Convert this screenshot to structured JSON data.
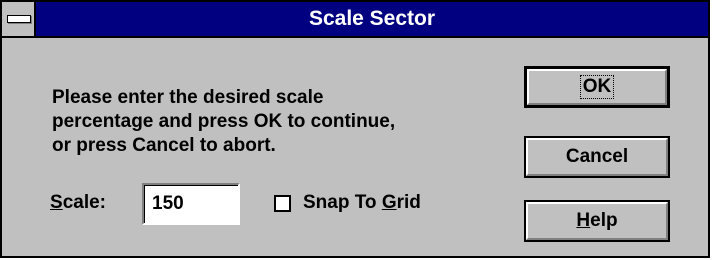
{
  "window": {
    "title": "Scale Sector"
  },
  "message": "Please enter the desired scale\npercentage and press OK to continue,\nor press Cancel to abort.",
  "scale": {
    "label_mnemonic": "S",
    "label_rest": "cale:",
    "value": "150"
  },
  "snap_to_grid": {
    "label_prefix": "Snap To ",
    "label_mnemonic": "G",
    "label_suffix": "rid",
    "checked": false
  },
  "buttons": {
    "ok_label": "OK",
    "cancel_label": "Cancel",
    "help_mnemonic": "H",
    "help_rest": "elp"
  },
  "colors": {
    "titlebar": "#000080",
    "face": "#c0c0c0"
  }
}
